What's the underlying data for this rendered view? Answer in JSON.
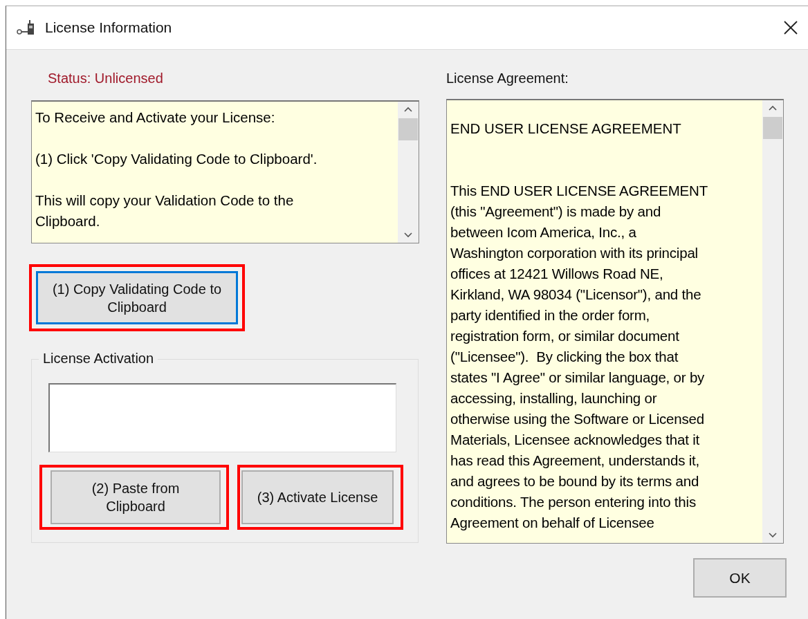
{
  "window": {
    "title": "License Information"
  },
  "status": "Status: Unlicensed",
  "instructions": [
    "To Receive and Activate your License:",
    "(1) Click 'Copy Validating Code to Clipboard'.",
    "This will copy your Validation Code to the\nClipboard."
  ],
  "copy_button": {
    "label": "(1) Copy Validating Code to Clipboard",
    "focused": true,
    "highlighted": true
  },
  "activation": {
    "title": "License Activation",
    "buttons": [
      {
        "label": "(2) Paste from Clipboard",
        "highlighted": true
      },
      {
        "label": "(3) Activate License",
        "highlighted": true
      }
    ]
  },
  "agreement": {
    "label": "License Agreement:",
    "heading": "END USER LICENSE AGREEMENT",
    "body": "This END USER LICENSE AGREEMENT\n(this \"Agreement\") is made by and\nbetween Icom America, Inc., a\nWashington corporation with its principal\noffices at 12421 Willows Road NE,\nKirkland, WA 98034 (\"Licensor\"), and the\nparty identified in the order form,\nregistration form, or similar document\n(\"Licensee\").  By clicking the box that\nstates \"I Agree\" or similar language, or by\naccessing, installing, launching or\notherwise using the Software or Licensed\nMaterials, Licensee acknowledges that it\nhas read this Agreement, understands it,\nand agrees to be bound by its terms and\nconditions. The person entering into this\nAgreement on behalf of Licensee"
  },
  "ok_button": "OK"
}
